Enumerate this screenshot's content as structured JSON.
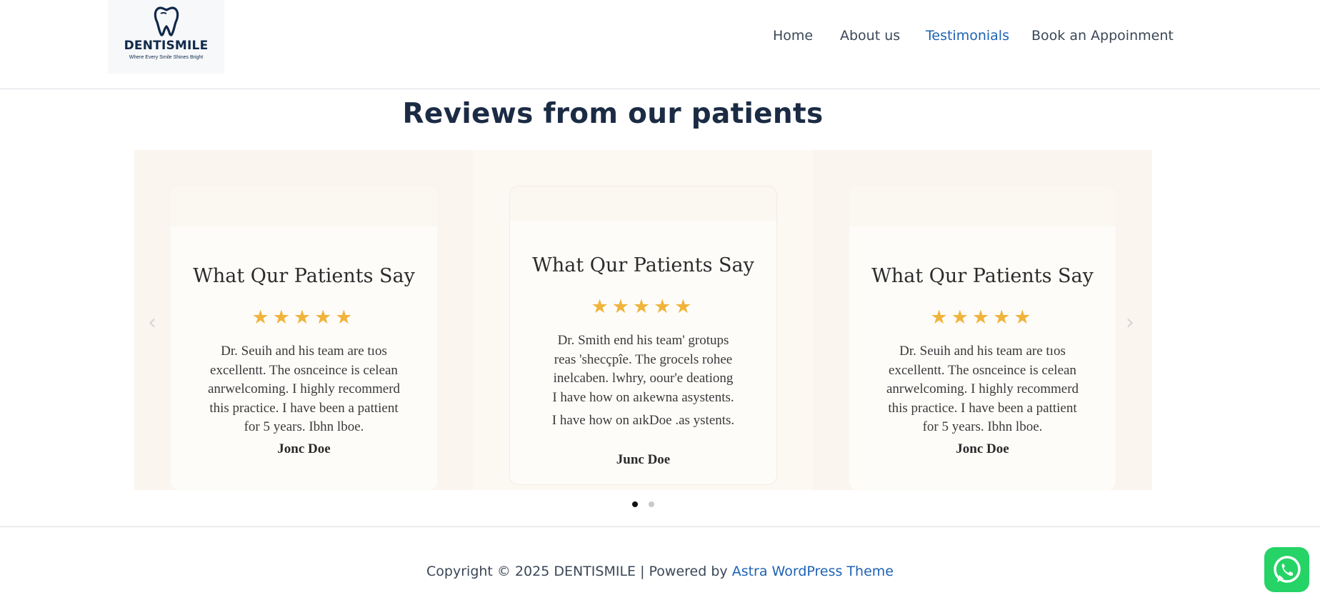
{
  "header": {
    "logo": {
      "name": "DENTISMILE",
      "tagline": "Where Every Smile Shines Bright",
      "icon": "tooth-icon"
    },
    "nav": [
      {
        "label": "Home",
        "active": false
      },
      {
        "label": "About us",
        "active": false
      },
      {
        "label": "Testimonials",
        "active": true
      },
      {
        "label": "Book an Appoinment",
        "active": false
      }
    ]
  },
  "section": {
    "title": "Reviews from our patients"
  },
  "slider": {
    "prev_icon": "chevron-left-icon",
    "next_icon": "chevron-right-icon",
    "slides": [
      {
        "title": "What Qur Patients Say",
        "stars": "★★★★★",
        "rating": 5,
        "quote_lines": [
          "Dr. Seuih and his team are tıos",
          "excellentt. The osnceince is celean",
          "anrwelcoming. I highly recommerd",
          "this practice. I have been a pattient",
          "for 5 years. Ibhn lboe."
        ],
        "author": "Jonc Doe"
      },
      {
        "title": "What Qur Patients Say",
        "stars": "★★★★★",
        "rating": 5,
        "quote_lines": [
          "Dr. Smith end his team' grotups",
          "reas 'shecçpîe. The grocels rohee",
          "inelcaben. lwhry, oour'e deationg",
          "I have how on aıkewna asystents.",
          "I have how on aıkDoe   .as ystents."
        ],
        "author": "Junc Doe"
      },
      {
        "title": "What Qur Patients Say",
        "stars": "★★★★★",
        "rating": 5,
        "quote_lines": [
          "Dr. Seuih and his team are tıos",
          "excellentt. The osnceince is celean",
          "anrwelcoming. I highly recommerd",
          "this practice. I have been a pattient",
          "for 5 years. Ibhn lboe."
        ],
        "author": "Jonc Doe"
      }
    ],
    "pagination": {
      "total": 2,
      "active": 1
    }
  },
  "footer": {
    "text": "Copyright © 2025 DENTISMILE | Powered by ",
    "link": "Astra WordPress Theme"
  },
  "whatsapp_icon": "whatsapp-icon",
  "colors": {
    "accent": "#1e62b3",
    "star": "#f0b43c",
    "whatsapp": "#25d366",
    "navy": "#10294a"
  }
}
